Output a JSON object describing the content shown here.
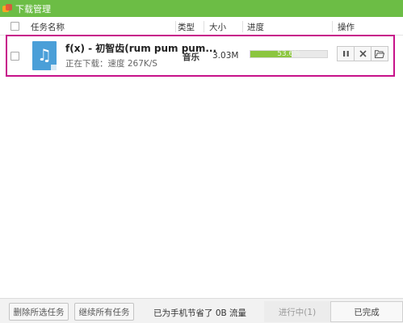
{
  "window": {
    "title": "下载管理"
  },
  "columns": {
    "name": "任务名称",
    "type": "类型",
    "size": "大小",
    "progress": "进度",
    "actions": "操作"
  },
  "task": {
    "name": "f(x) - 初智齿(rum pum pum...",
    "status": "正在下载：速度 267K/S",
    "type": "音乐",
    "size": "3.03M",
    "progress_percent": 53.6,
    "progress_label": "53.6%",
    "icon": "music-file-icon",
    "buttons": [
      "pause-icon",
      "cancel-icon",
      "open-folder-icon"
    ]
  },
  "footer": {
    "delete_selected": "删除所选任务",
    "continue_all": "继续所有任务",
    "saved_traffic": "已为手机节省了 0B 流量",
    "tab_in_progress": "进行中(1)",
    "tab_completed": "已完成"
  },
  "colors": {
    "titlebar": "#6cbd45",
    "highlight": "#c7128a",
    "progress": "#8cc63f",
    "music_icon": "#4a9fd8"
  }
}
